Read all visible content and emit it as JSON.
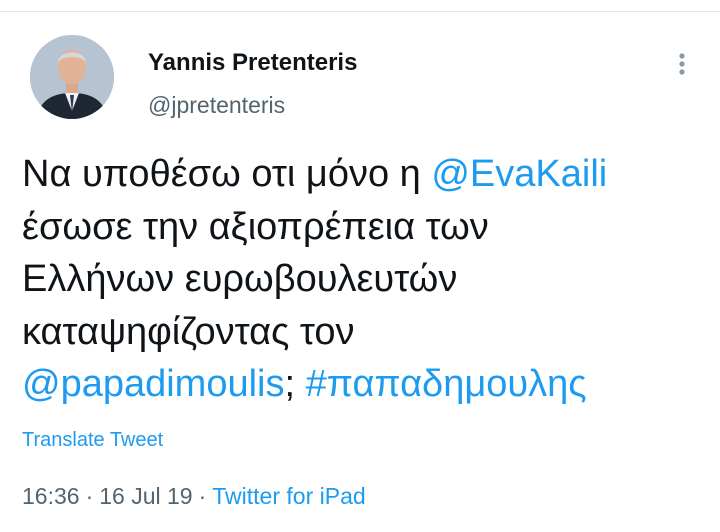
{
  "author": {
    "display_name": "Yannis Pretenteris",
    "handle": "@jpretenteris"
  },
  "tweet": {
    "lines": [
      [
        {
          "text": "Να υποθέσω οτι μόνο η ",
          "kind": "text"
        },
        {
          "text": "@EvaKaili",
          "kind": "mention"
        }
      ],
      [
        {
          "text": "έσωσε την αξιοπρέπεια των",
          "kind": "text"
        }
      ],
      [
        {
          "text": "Ελλήνων ευρωβουλευτών",
          "kind": "text"
        }
      ],
      [
        {
          "text": "καταψηφίζοντας τον",
          "kind": "text"
        }
      ],
      [
        {
          "text": "@papadimoulis",
          "kind": "mention"
        },
        {
          "text": "; ",
          "kind": "text"
        },
        {
          "text": "#παπαδημουλης",
          "kind": "hashtag"
        }
      ]
    ]
  },
  "translate_label": "Translate Tweet",
  "meta": {
    "time": "16:36",
    "separator": "·",
    "date": "16 Jul 19",
    "source": "Twitter for iPad"
  },
  "icons": {
    "more": "more-vertical-icon"
  },
  "colors": {
    "link": "#1d9bf0",
    "text": "#0f1419",
    "secondary": "#536471"
  }
}
